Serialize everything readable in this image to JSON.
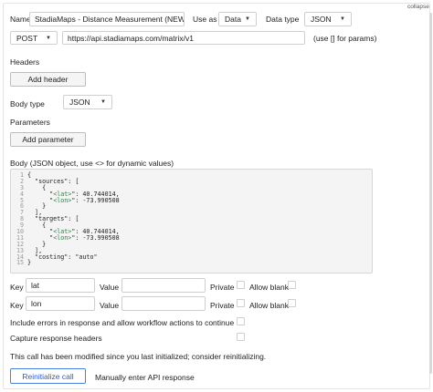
{
  "collapse_label": "collapse",
  "name_label": "Name",
  "name_value": "StadiaMaps - Distance Measurement (NEW",
  "use_as_label": "Use as",
  "use_as_value": "Data",
  "data_type_label": "Data type",
  "data_type_value": "JSON",
  "method_value": "POST",
  "url_value": "https://api.stadiamaps.com/matrix/v1",
  "url_hint": "(use [] for params)",
  "headers_label": "Headers",
  "add_header_label": "Add header",
  "body_type_label": "Body type",
  "body_type_value": "JSON",
  "parameters_label": "Parameters",
  "add_parameter_label": "Add parameter",
  "body_label": "Body (JSON object, use <> for dynamic values)",
  "code_lines": [
    "{",
    "  \"sources\": [",
    "    {",
    "      \"<lat>\": 40.744014,",
    "      \"<lon>\": -73.990508",
    "    }",
    "  ],",
    "  \"targets\": [",
    "    {",
    "      \"<lat>\": 40.744014,",
    "      \"<lon>\": -73.990508",
    "    }",
    "  ],",
    "  \"costing\": \"auto\"",
    "}"
  ],
  "line_numbers": [
    "1",
    "2",
    "3",
    "4",
    "5",
    "6",
    "7",
    "8",
    "9",
    "10",
    "11",
    "12",
    "13",
    "14",
    "15"
  ],
  "param_rows": [
    {
      "key_label": "Key",
      "key_value": "lat",
      "value_label": "Value",
      "private_label": "Private",
      "allow_blank_label": "Allow blank"
    },
    {
      "key_label": "Key",
      "key_value": "lon",
      "value_label": "Value",
      "private_label": "Private",
      "allow_blank_label": "Allow blank"
    }
  ],
  "include_errors_label": "Include errors in response and allow workflow actions to continue",
  "capture_headers_label": "Capture response headers",
  "modified_notice": "This call has been modified since you last initialized; consider reinitializing.",
  "reinitialize_label": "Reinitialize call",
  "manual_response_label": "Manually enter API response",
  "colors": {
    "accent": "#4a7ee3",
    "border": "#cfcfcf",
    "code_bg": "#f4f4f4"
  }
}
